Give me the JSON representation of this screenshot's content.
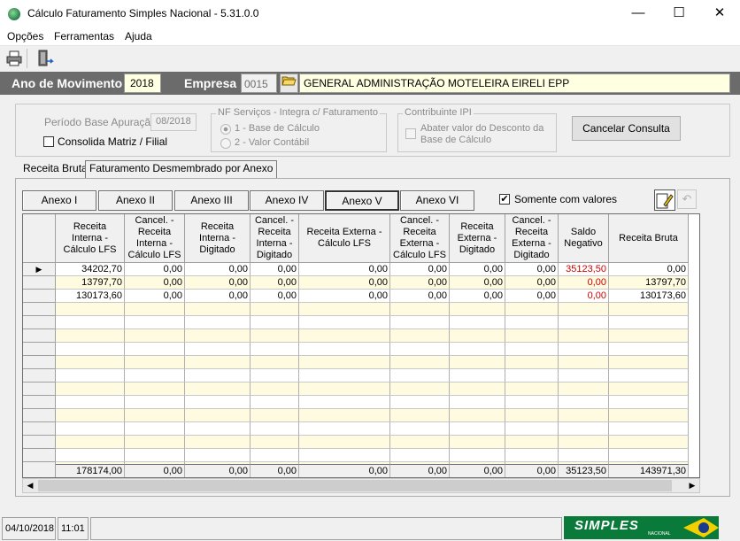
{
  "window": {
    "title": "Cálculo Faturamento Simples Nacional - 5.31.0.0",
    "minimize": "—",
    "maximize": "☐",
    "close": "✕"
  },
  "menu": [
    {
      "label": "Opções"
    },
    {
      "label": "Ferramentas"
    },
    {
      "label": "Ajuda"
    }
  ],
  "toolbar": {
    "print_icon": "printer-icon",
    "exit_icon": "exit-door-icon"
  },
  "header": {
    "ano_label": "Ano de Movimento",
    "ano_value": "2018",
    "empresa_label": "Empresa",
    "empresa_code": "0015",
    "empresa_name": "GENERAL ADMINISTRAÇÃO MOTELEIRA EIRELI EPP"
  },
  "filters": {
    "periodo_label": "Período Base Apuração:",
    "periodo_value": "08/2018",
    "consolida_label": "Consolida Matriz / Filial",
    "nf_group": "NF Serviços - Integra c/ Faturamento",
    "nf_opt1": "1 - Base de Cálculo",
    "nf_opt2": "2 - Valor Contábil",
    "ipi_group": "Contribuinte IPI",
    "ipi_check1": "Abater valor do Desconto da",
    "ipi_check2": "Base de Cálculo",
    "cancel_button": "Cancelar Consulta"
  },
  "tabs": [
    {
      "label": "Receita Bruta"
    },
    {
      "label": "Faturamento Desmembrado por Anexo"
    }
  ],
  "anexos": [
    "Anexo I",
    "Anexo II",
    "Anexo III",
    "Anexo IV",
    "Anexo V",
    "Anexo VI"
  ],
  "somente_label": "Somente com valores",
  "grid": {
    "headers": [
      "Receita Interna - Cálculo LFS",
      "Cancel. - Receita Interna - Cálculo LFS",
      "Receita Interna - Digitado",
      "Cancel. - Receita Interna - Digitado",
      "Receita Externa - Cálculo LFS",
      "Cancel. - Receita Externa - Cálculo LFS",
      "Receita Externa - Digitado",
      "Cancel. - Receita Externa - Digitado",
      "Saldo Negativo",
      "Receita Bruta"
    ],
    "rows": [
      [
        "34202,70",
        "0,00",
        "0,00",
        "0,00",
        "0,00",
        "0,00",
        "0,00",
        "0,00",
        "35123,50",
        "0,00"
      ],
      [
        "13797,70",
        "0,00",
        "0,00",
        "0,00",
        "0,00",
        "0,00",
        "0,00",
        "0,00",
        "0,00",
        "13797,70"
      ],
      [
        "130173,60",
        "0,00",
        "0,00",
        "0,00",
        "0,00",
        "0,00",
        "0,00",
        "0,00",
        "0,00",
        "130173,60"
      ]
    ],
    "totals": [
      "178174,00",
      "0,00",
      "0,00",
      "0,00",
      "0,00",
      "0,00",
      "0,00",
      "0,00",
      "35123,50",
      "143971,30"
    ],
    "empty_row_count": 15
  },
  "status": {
    "date": "04/10/2018",
    "time": "11:01",
    "logo_text": "SIMPLES",
    "logo_sub": "NACIONAL"
  },
  "colors": {
    "header_band": "#6b6b6b",
    "highlight_yellow": "#ffffe1",
    "negative_red": "#d00000",
    "logo_green": "#0a7a3a"
  }
}
